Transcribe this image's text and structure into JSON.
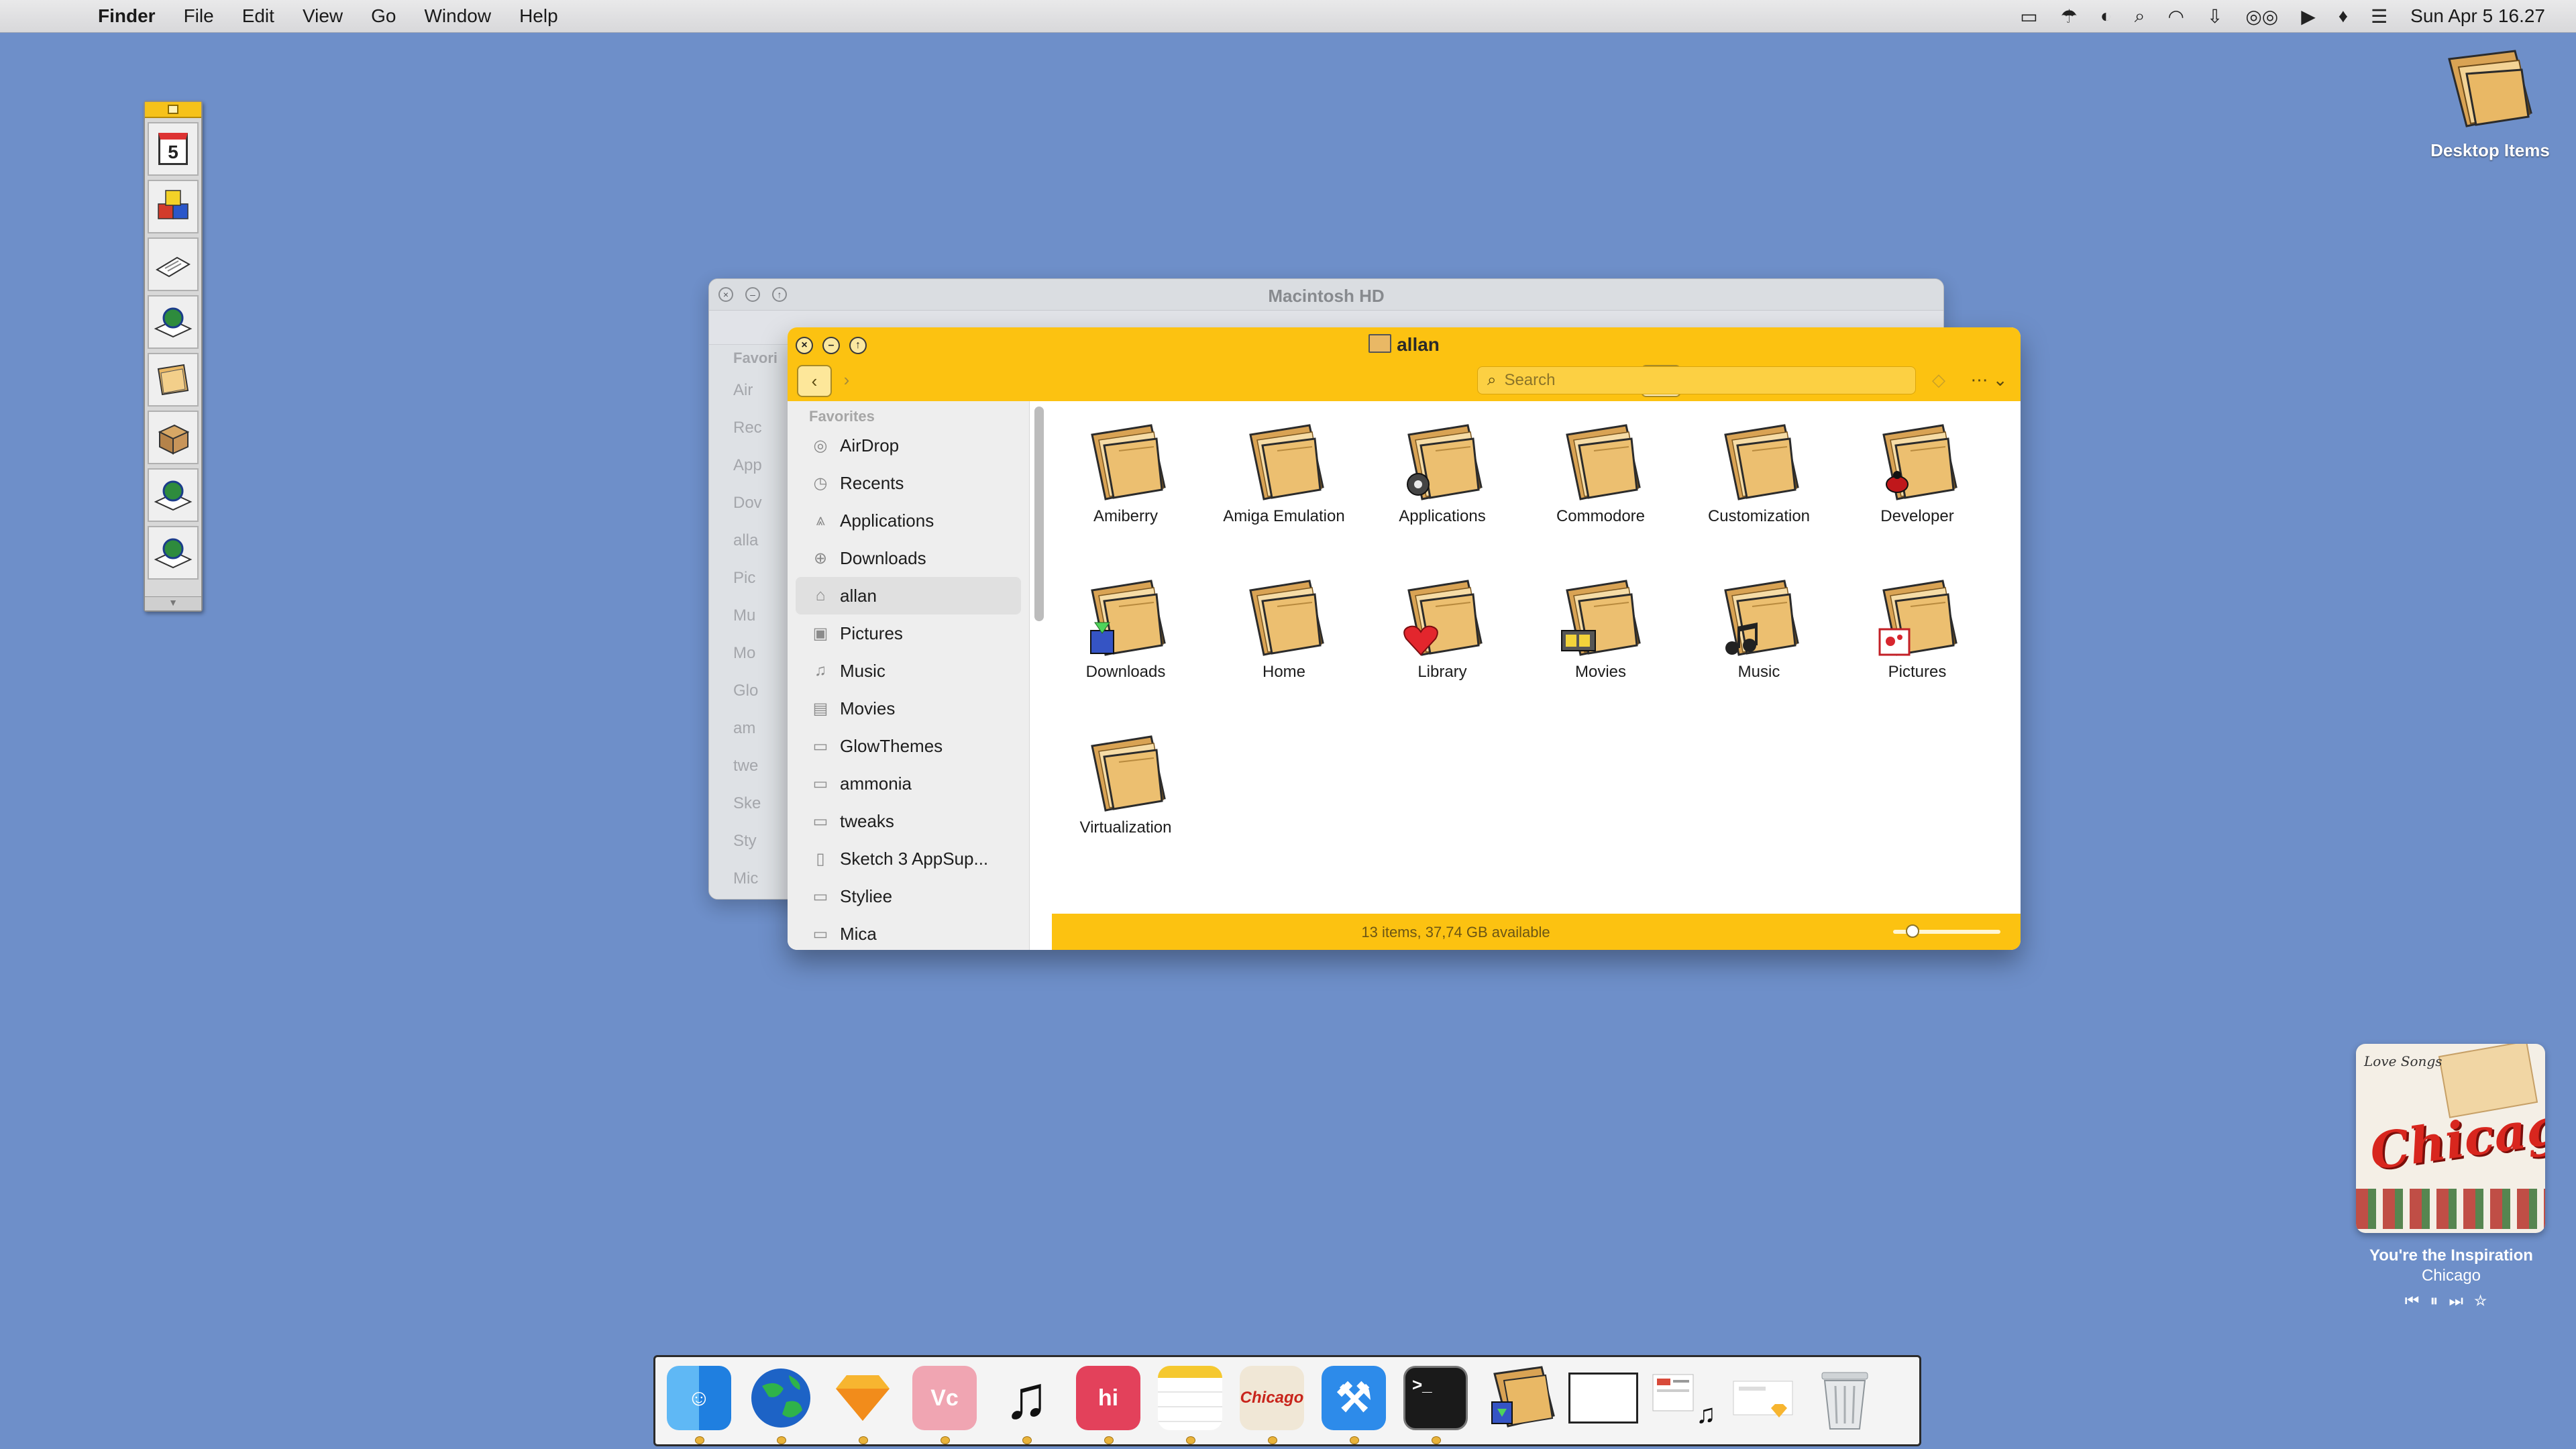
{
  "menubar": {
    "app_name": "Finder",
    "menus": [
      "File",
      "Edit",
      "View",
      "Go",
      "Window",
      "Help"
    ],
    "clock": "Sun Apr 5  16.27",
    "status_icons": [
      "display-icon",
      "umbrella-icon",
      "appearance-icon",
      "spotlight-icon",
      "wifi-icon",
      "download-icon",
      "eyes-icon",
      "play-icon",
      "drop-icon",
      "control-center-icon"
    ]
  },
  "launcher": {
    "calendar_day": "5",
    "items": [
      "blocks-icon",
      "document-icon",
      "globe-icon",
      "folder-icon",
      "package-icon",
      "globe-icon",
      "globe-icon"
    ]
  },
  "desktop": {
    "desktop_items_label": "Desktop Items"
  },
  "back_window": {
    "title": "Macintosh HD",
    "sidebar_header": "Favori",
    "sidebar": [
      "Air",
      "Rec",
      "App",
      "Dov",
      "alla",
      "Pic",
      "Mu",
      "Mo",
      "Glo",
      "am",
      "twe",
      "Ske",
      "Sty",
      "Mic"
    ]
  },
  "window": {
    "title": "allan",
    "search_placeholder": "Search",
    "sidebar_header": "Favorites",
    "sidebar": [
      {
        "label": "AirDrop",
        "icon": "airdrop-icon"
      },
      {
        "label": "Recents",
        "icon": "clock-icon"
      },
      {
        "label": "Applications",
        "icon": "applications-icon"
      },
      {
        "label": "Downloads",
        "icon": "download-icon"
      },
      {
        "label": "allan",
        "icon": "home-icon",
        "selected": true
      },
      {
        "label": "Pictures",
        "icon": "pictures-icon"
      },
      {
        "label": "Music",
        "icon": "music-icon"
      },
      {
        "label": "Movies",
        "icon": "film-icon"
      },
      {
        "label": "GlowThemes",
        "icon": "folder-icon"
      },
      {
        "label": "ammonia",
        "icon": "folder-icon"
      },
      {
        "label": "tweaks",
        "icon": "folder-icon"
      },
      {
        "label": "Sketch 3 AppSup...",
        "icon": "document-icon"
      },
      {
        "label": "Styliee",
        "icon": "folder-icon"
      },
      {
        "label": "Mica",
        "icon": "folder-icon"
      }
    ],
    "items": [
      {
        "name": "Amiberry",
        "badge": "none"
      },
      {
        "name": "Amiga Emulation",
        "badge": "none"
      },
      {
        "name": "Applications",
        "badge": "gear"
      },
      {
        "name": "Commodore",
        "badge": "none"
      },
      {
        "name": "Customization",
        "badge": "none"
      },
      {
        "name": "Developer",
        "badge": "bug"
      },
      {
        "name": "Downloads",
        "badge": "download"
      },
      {
        "name": "Home",
        "badge": "none"
      },
      {
        "name": "Library",
        "badge": "heart"
      },
      {
        "name": "Movies",
        "badge": "film"
      },
      {
        "name": "Music",
        "badge": "notes"
      },
      {
        "name": "Pictures",
        "badge": "picture"
      },
      {
        "name": "Virtualization",
        "badge": "none"
      }
    ],
    "status": "13 items, 37,74 GB available",
    "icon_size_fraction": 0.12
  },
  "now_playing": {
    "album_tagline": "Love Songs",
    "album_band": "Chicago",
    "song": "You're the Inspiration",
    "artist": "Chicago",
    "controls": [
      "⏮",
      "⏸",
      "⏭",
      "☆"
    ]
  },
  "dock": {
    "items": [
      "finder",
      "browser",
      "sketch",
      "vectorize",
      "music",
      "hi-app",
      "notes",
      "chicago-album",
      "xcode",
      "terminal",
      "downloads-stack",
      "window-preview",
      "document-preview",
      "sketch-preview",
      "trash"
    ],
    "running": [
      "finder",
      "browser",
      "sketch",
      "vectorize",
      "music",
      "hi-app",
      "notes",
      "chicago-album",
      "xcode",
      "terminal"
    ],
    "terminal_prompt": ">_",
    "hi_label": "hi"
  },
  "colors": {
    "desktop": "#6e8fc9",
    "finder_yellow": "#fcc211",
    "folder": "#e9b865"
  }
}
